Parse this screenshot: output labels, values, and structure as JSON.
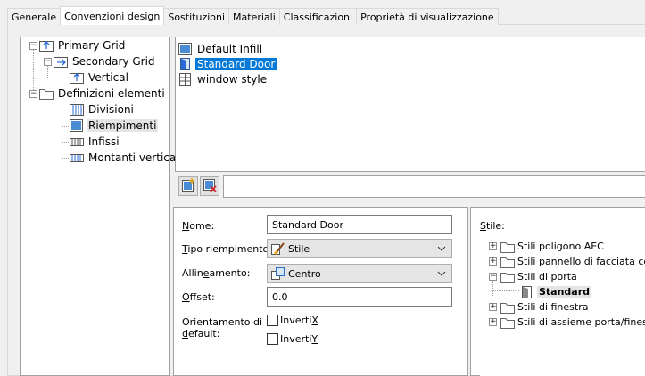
{
  "tabs": [
    {
      "label": "Generale"
    },
    {
      "label": "Convenzioni design"
    },
    {
      "label": "Sostituzioni"
    },
    {
      "label": "Materiali"
    },
    {
      "label": "Classificazioni"
    },
    {
      "label": "Proprietà di visualizzazione"
    }
  ],
  "active_tab": "Convenzioni design",
  "tree": {
    "primary_grid": "Primary Grid",
    "secondary_grid": "Secondary Grid",
    "vertical": "Vertical",
    "definizioni": "Definizioni elementi",
    "divisioni": "Divisioni",
    "riempimenti": "Riempimenti",
    "infissi": "Infissi",
    "montanti": "Montanti verticali"
  },
  "tree_selected": "Riempimenti",
  "infill_list": [
    {
      "label": "Default Infill",
      "icon": "infill-icon",
      "selected": false
    },
    {
      "label": "Standard Door",
      "icon": "door-icon",
      "selected": true
    },
    {
      "label": "window style",
      "icon": "window-icon",
      "selected": false
    }
  ],
  "buttons": {
    "add": "add-infill-icon",
    "remove": "remove-infill-icon"
  },
  "props": {
    "nome_label_u": "N",
    "nome_label_rest": "ome:",
    "nome_value": "Standard Door",
    "tipo_label_u": "T",
    "tipo_label_rest": "ipo riempimento:",
    "tipo_value": "Stile",
    "allin_label_pre": "Allin",
    "allin_label_u": "e",
    "allin_label_rest": "amento:",
    "allin_value": "Centro",
    "offset_label_u": "O",
    "offset_label_rest": "ffset:",
    "offset_value": "0.0",
    "orient_line1": "Orientamento di",
    "orient_line2_u": "d",
    "orient_line2_rest": "efault:",
    "invert_x_pre": "Inverti ",
    "invert_x_u": "X",
    "invert_x_checked": false,
    "invert_y_pre": "Inverti ",
    "invert_y_u": "Y",
    "invert_y_checked": false
  },
  "stili": {
    "label_u": "S",
    "label_rest": "tile:",
    "items": [
      {
        "label": "Stili poligono AEC"
      },
      {
        "label": "Stili pannello di facciata continua"
      },
      {
        "label": "Stili di porta"
      },
      {
        "label": "Standard"
      },
      {
        "label": "Stili di finestra"
      },
      {
        "label": "Stili di assieme porta/finestra"
      }
    ]
  }
}
